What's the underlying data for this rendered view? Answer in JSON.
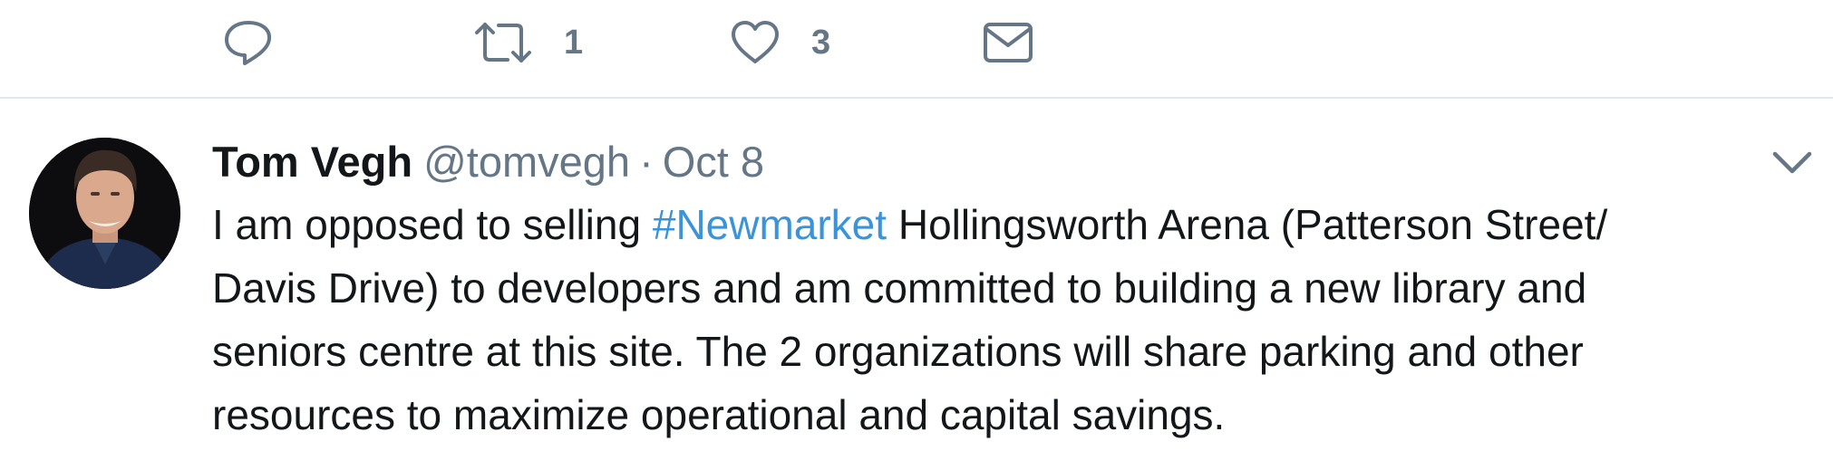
{
  "actions": {
    "reply": {
      "count": ""
    },
    "retweet": {
      "count": "1"
    },
    "like": {
      "count": "3"
    },
    "direct_message": {
      "count": ""
    }
  },
  "icons": {
    "reply": "reply-icon",
    "retweet": "retweet-icon",
    "like": "heart-icon",
    "direct_message": "envelope-icon",
    "menu": "chevron-down-icon",
    "avatar": "profile-photo"
  },
  "colors": {
    "icon_gray": "#657786",
    "text": "#14171a",
    "hashtag": "#3b94d9",
    "divider": "#e1e8ed"
  },
  "tweet": {
    "author_name": "Tom Vegh",
    "author_handle": "@tomvegh",
    "separator": "·",
    "date": "Oct 8",
    "text_line_1_before": "I am opposed to selling ",
    "hashtag": "#Newmarket",
    "text_line_1_after": " Hollingsworth Arena (Patterson Street/",
    "text_line_2": "Davis Drive) to developers and am committed to building a new library and",
    "text_line_3": "seniors centre at this site. The 2 organizations will share parking and other",
    "text_line_4": "resources to maximize operational and capital savings."
  }
}
